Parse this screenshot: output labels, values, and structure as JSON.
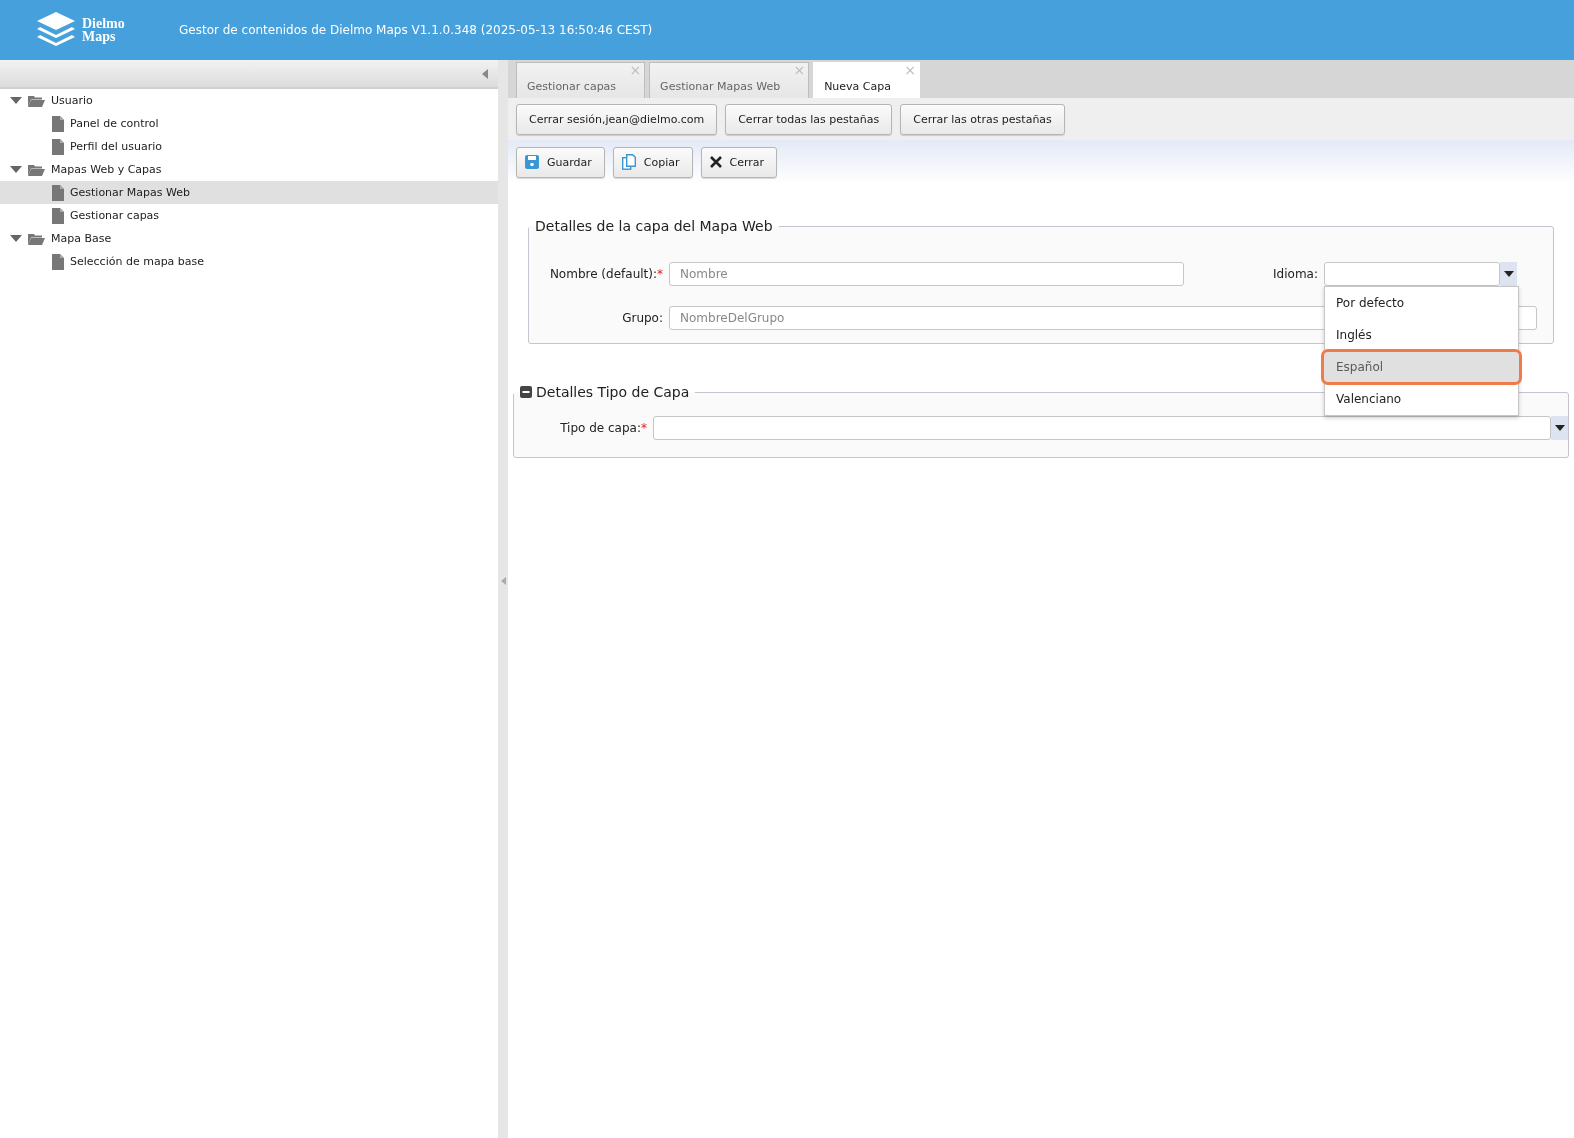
{
  "header": {
    "logo_line1": "Dielmo",
    "logo_line2": "Maps",
    "title": "Gestor de contenidos de Dielmo Maps V1.1.0.348 (2025-05-13 16:50:46 CEST)"
  },
  "tree": [
    {
      "label": "Usuario",
      "kind": "folder",
      "expanded": true,
      "selected": false,
      "children": [
        {
          "label": "Panel de control",
          "kind": "page",
          "selected": false
        },
        {
          "label": "Perfil del usuario",
          "kind": "page",
          "selected": false
        }
      ]
    },
    {
      "label": "Mapas Web y Capas",
      "kind": "folder",
      "expanded": true,
      "selected": false,
      "children": [
        {
          "label": "Gestionar Mapas Web",
          "kind": "page",
          "selected": true
        },
        {
          "label": "Gestionar capas",
          "kind": "page",
          "selected": false
        }
      ]
    },
    {
      "label": "Mapa Base",
      "kind": "folder",
      "expanded": true,
      "selected": false,
      "children": [
        {
          "label": "Selección de mapa base",
          "kind": "page",
          "selected": false
        }
      ]
    }
  ],
  "tabs": [
    {
      "label": "Gestionar capas",
      "selected": false,
      "close": "×"
    },
    {
      "label": "Gestionar Mapas Web",
      "selected": false,
      "close": "×"
    },
    {
      "label": "Nueva Capa",
      "selected": true,
      "close": "×"
    }
  ],
  "session_buttons": [
    "Cerrar sesión,jean@dielmo.com",
    "Cerrar todas las pestañas",
    "Cerrar las otras pestañas"
  ],
  "actions": [
    {
      "label": "Guardar",
      "kind": "save"
    },
    {
      "label": "Copiar",
      "kind": "copy"
    },
    {
      "label": "Cerrar",
      "kind": "close"
    }
  ],
  "layer_details": {
    "title": "Detalles de la capa del Mapa Web",
    "name_label": "Nombre (default):",
    "name_required": "*",
    "name_placeholder": "Nombre",
    "language_label": "Idioma:",
    "group_label": "Grupo:",
    "group_placeholder": "NombreDelGrupo",
    "language_options": [
      {
        "label": "Por defecto",
        "selected": false
      },
      {
        "label": "Inglés",
        "selected": false
      },
      {
        "label": "Español",
        "selected": true
      },
      {
        "label": "Valenciano",
        "selected": false
      }
    ]
  },
  "type_details": {
    "title": "Detalles Tipo de Capa",
    "expanded": true,
    "type_label": "Tipo de capa:",
    "type_required": "*"
  }
}
